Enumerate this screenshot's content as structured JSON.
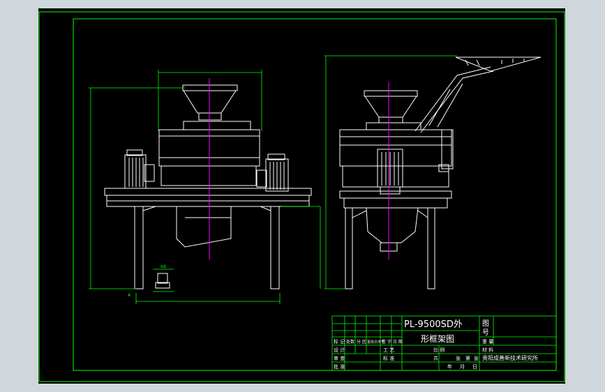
{
  "colors": {
    "background": "#000000",
    "surround": "#cfd6dc",
    "frame": "#00ff00",
    "outline": "#ffffff",
    "centerline": "#ff00ff",
    "dimension": "#00ff00",
    "title_text": "#ffffff"
  },
  "drawing": {
    "title_line1": "PL-9500SD外",
    "title_line2": "形框架图",
    "top_right_cell_top": "图",
    "top_right_cell_bottom": "号",
    "detail_dim": "A向",
    "view_mark": "A"
  },
  "title_block": {
    "left_rows": [
      "标 记",
      "设 计",
      "审 查",
      "批 准"
    ],
    "header_row": [
      "处数",
      "分 区",
      "更改文件号",
      "签 字",
      "日 期"
    ],
    "mid_labels": [
      "工 艺",
      "标 准"
    ],
    "right_labels": [
      "比 例",
      "重 量",
      "材 料"
    ],
    "sheet_row": [
      "共",
      "张",
      "第",
      "张"
    ],
    "organization": "贵阳成善新技术研究所",
    "date_row": [
      "年",
      "月",
      "日"
    ]
  }
}
